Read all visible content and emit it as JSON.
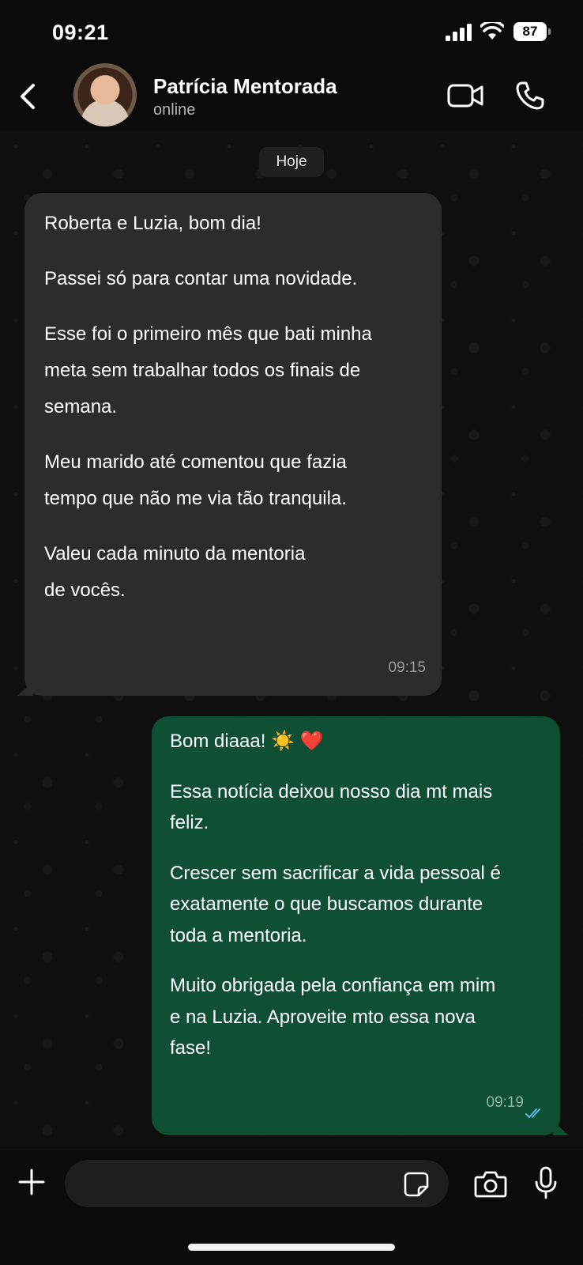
{
  "status_bar": {
    "time": "09:21",
    "battery": "87"
  },
  "header": {
    "contact_name": "Patrícia Mentorada",
    "contact_status": "online"
  },
  "date_separator": "Hoje",
  "messages": [
    {
      "direction": "incoming",
      "lines": [
        "Roberta e Luzia, bom dia!",
        "",
        "Passei só para contar uma novidade.",
        "",
        "Esse foi o primeiro mês que bati minha",
        "meta sem trabalhar todos os finais de",
        "semana.",
        "",
        "Meu marido até comentou que fazia",
        "tempo que não me via tão tranquila.",
        "",
        "Valeu cada minuto da mentoria",
        "de vocês."
      ],
      "time": "09:15"
    },
    {
      "direction": "outgoing",
      "lines": [
        "Bom diaaa! ☀️ ❤️",
        "",
        "Essa notícia deixou nosso dia mt mais",
        "feliz.",
        "",
        "Crescer sem sacrificar a vida pessoal é",
        "exatamente o que buscamos durante",
        "toda a mentoria.",
        "",
        "Muito obrigada pela confiança em mim",
        "e na Luzia. Aproveite mto essa nova",
        "fase!"
      ],
      "time": "09:19",
      "status": "read"
    }
  ],
  "input": {
    "value": "",
    "placeholder": ""
  },
  "colors": {
    "incoming_bubble": "#2c2c2e",
    "outgoing_bubble": "#0f4f33",
    "read_ticks": "#53bdeb"
  }
}
